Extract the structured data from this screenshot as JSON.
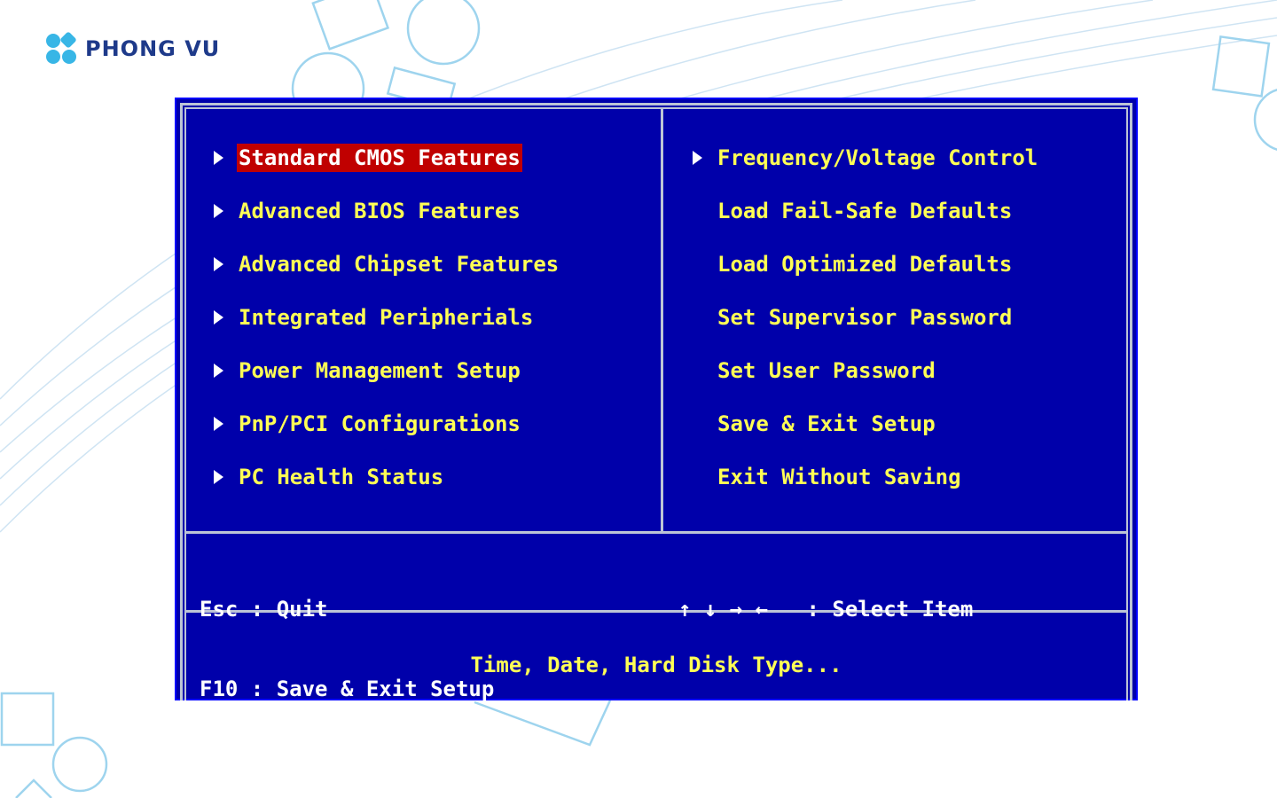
{
  "brand": {
    "name": "PHONG VU",
    "colors": {
      "logo_mark": "#38b6e6",
      "logo_text": "#1e3a8a"
    }
  },
  "bios": {
    "colors": {
      "background": "#0000aa",
      "text": "#ffff55",
      "highlight": "#c00000",
      "frame": "#bcc4d6"
    },
    "left_menu": [
      {
        "label": "Standard CMOS Features",
        "has_arrow": true,
        "selected": true
      },
      {
        "label": "Advanced BIOS Features",
        "has_arrow": true
      },
      {
        "label": "Advanced Chipset Features",
        "has_arrow": true
      },
      {
        "label": "Integrated Peripherials",
        "has_arrow": true
      },
      {
        "label": "Power Management Setup",
        "has_arrow": true
      },
      {
        "label": "PnP/PCI Configurations",
        "has_arrow": true
      },
      {
        "label": "PC Health Status",
        "has_arrow": true
      }
    ],
    "right_menu": [
      {
        "label": "Frequency/Voltage Control",
        "has_arrow": true
      },
      {
        "label": "Load Fail-Safe Defaults",
        "has_arrow": false
      },
      {
        "label": "Load Optimized Defaults",
        "has_arrow": false
      },
      {
        "label": "Set Supervisor Password",
        "has_arrow": false
      },
      {
        "label": "Set User Password",
        "has_arrow": false
      },
      {
        "label": "Save & Exit Setup",
        "has_arrow": false
      },
      {
        "label": "Exit Without Saving",
        "has_arrow": false
      }
    ],
    "help": {
      "esc": "Esc : Quit",
      "f10": "F10 : Save & Exit Setup",
      "arrows": "↑ ↓ → ←   : Select Item"
    },
    "description": "Time, Date, Hard Disk Type..."
  }
}
